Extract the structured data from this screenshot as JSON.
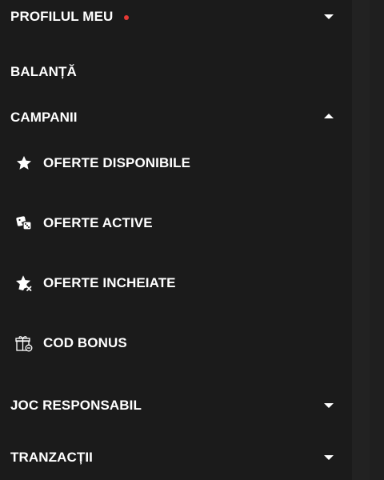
{
  "menu": {
    "profile": {
      "label": "PROFILUL MEU",
      "has_notification": true,
      "expanded": false
    },
    "balance": {
      "label": "BALANȚĂ"
    },
    "campaigns": {
      "label": "CAMPANII",
      "expanded": true,
      "items": [
        {
          "label": "OFERTE DISPONIBILE",
          "icon": "star-icon"
        },
        {
          "label": "OFERTE ACTIVE",
          "icon": "dice-icon"
        },
        {
          "label": "OFERTE INCHEIATE",
          "icon": "star-x-icon"
        },
        {
          "label": "COD BONUS",
          "icon": "gift-icon"
        }
      ]
    },
    "responsible": {
      "label": "JOC RESPONSABIL",
      "expanded": false
    },
    "transactions": {
      "label": "TRANZACȚII",
      "expanded": false
    }
  },
  "colors": {
    "background": "#1b1b1b",
    "text": "#ffffff",
    "notification_dot": "#e53935"
  }
}
